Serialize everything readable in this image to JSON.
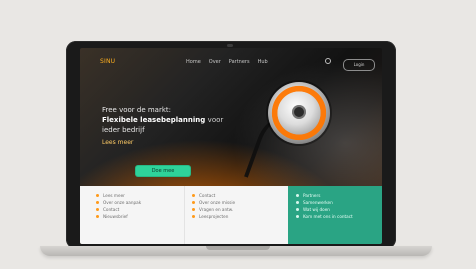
{
  "site": {
    "logo_text": "SINU",
    "nav": [
      "Home",
      "Over",
      "Partners",
      "Hub"
    ],
    "cta_pill": "Login"
  },
  "hero": {
    "line1": "Free voor de markt:",
    "line2_bold": "Flexibele leasebeplanning",
    "line2_muted": "voor",
    "line3": "ieder bedrijf",
    "subline": "Lees meer",
    "button_label": "Doe mee"
  },
  "sections": {
    "col1": [
      "Lees meer",
      "Over onze aanpak",
      "Contact",
      "Nieuwsbrief"
    ],
    "col2": [
      "Contact",
      "Over onze missie",
      "Vragen en antw.",
      "Leesprojecten"
    ],
    "col3": [
      "Partners",
      "Samenwerken",
      "Wat wij doen",
      "Kom met ons in contact"
    ]
  },
  "icons": {
    "top_right": "map-pin-icon"
  },
  "colors": {
    "accent_orange": "#ff8a00",
    "accent_green": "#2aa484",
    "button_green": "#2ed39a",
    "logo_orange": "#ffb01f"
  }
}
